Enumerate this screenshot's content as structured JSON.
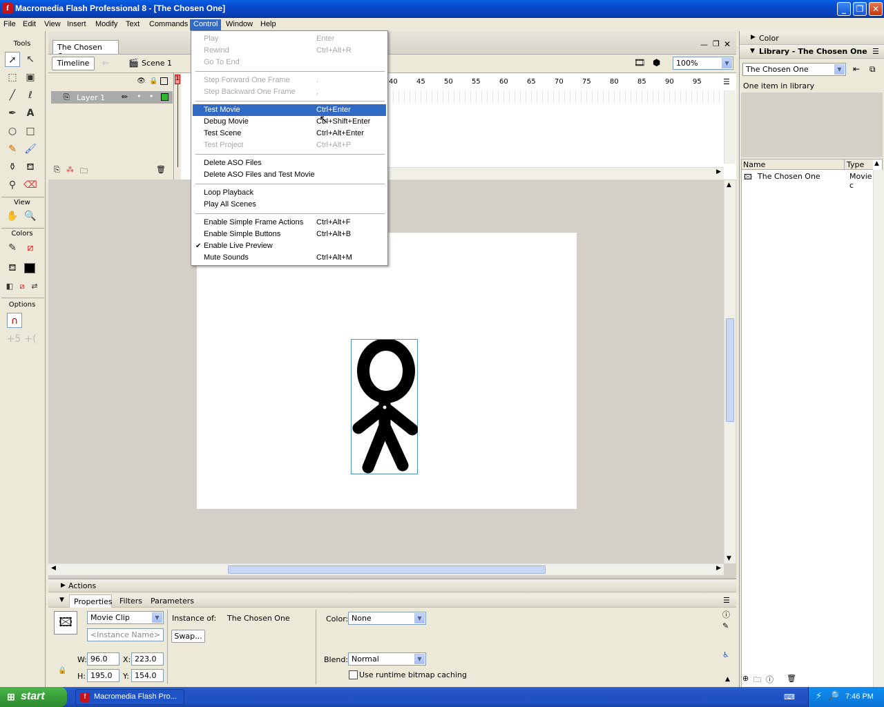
{
  "window": {
    "title": "Macromedia Flash Professional 8 - [The Chosen One]",
    "app_icon": "flash-icon"
  },
  "menubar": [
    "File",
    "Edit",
    "View",
    "Insert",
    "Modify",
    "Text",
    "Commands",
    "Control",
    "Window",
    "Help"
  ],
  "menubar_active": "Control",
  "control_menu": {
    "group1": [
      {
        "label": "Play",
        "shortcut": "Enter",
        "disabled": true
      },
      {
        "label": "Rewind",
        "shortcut": "Ctrl+Alt+R",
        "disabled": true
      },
      {
        "label": "Go To End",
        "shortcut": "",
        "disabled": true
      }
    ],
    "group2": [
      {
        "label": "Step Forward One Frame",
        "shortcut": ".",
        "disabled": true
      },
      {
        "label": "Step Backward One Frame",
        "shortcut": ",",
        "disabled": true
      }
    ],
    "group3": [
      {
        "label": "Test Movie",
        "shortcut": "Ctrl+Enter",
        "highlighted": true
      },
      {
        "label": "Debug Movie",
        "shortcut": "Ctrl+Shift+Enter"
      },
      {
        "label": "Test Scene",
        "shortcut": "Ctrl+Alt+Enter"
      },
      {
        "label": "Test Project",
        "shortcut": "Ctrl+Alt+P",
        "disabled": true
      }
    ],
    "group4": [
      {
        "label": "Delete ASO Files",
        "shortcut": ""
      },
      {
        "label": "Delete ASO Files and Test Movie",
        "shortcut": ""
      }
    ],
    "group5": [
      {
        "label": "Loop Playback",
        "shortcut": ""
      },
      {
        "label": "Play All Scenes",
        "shortcut": ""
      }
    ],
    "group6": [
      {
        "label": "Enable Simple Frame Actions",
        "shortcut": "Ctrl+Alt+F"
      },
      {
        "label": "Enable Simple Buttons",
        "shortcut": "Ctrl+Alt+B"
      },
      {
        "label": "Enable Live Preview",
        "shortcut": "",
        "checked": true
      },
      {
        "label": "Mute Sounds",
        "shortcut": "Ctrl+Alt+M"
      }
    ]
  },
  "tools": {
    "label": "Tools",
    "view_label": "View",
    "colors_label": "Colors",
    "options_label": "Options"
  },
  "document": {
    "tab": "The Chosen One",
    "timeline_button": "Timeline",
    "scene": "Scene 1",
    "zoom": "100%",
    "layer": "Layer 1",
    "frame_numbers": [
      "40",
      "45",
      "50",
      "55",
      "60",
      "65",
      "70",
      "75",
      "80",
      "85",
      "90",
      "95"
    ],
    "playhead": "1"
  },
  "library": {
    "color_panel": "Color",
    "title": "Library - The Chosen One",
    "dropdown": "The Chosen One",
    "count": "One item in library",
    "columns": [
      "Name",
      "Type"
    ],
    "items": [
      {
        "name": "The Chosen One",
        "type": "Movie c"
      }
    ]
  },
  "actions_panel": "Actions",
  "properties": {
    "tabs": [
      "Properties",
      "Filters",
      "Parameters"
    ],
    "symbol_type": "Movie Clip",
    "instance_name_placeholder": "<Instance Name>",
    "instance_of_label": "Instance of:",
    "instance_of": "The Chosen One",
    "swap_label": "Swap...",
    "color_label": "Color:",
    "color_value": "None",
    "w_label": "W:",
    "w": "96.0",
    "h_label": "H:",
    "h": "195.0",
    "x_label": "X:",
    "x": "223.0",
    "y_label": "Y:",
    "y": "154.0",
    "blend_label": "Blend:",
    "blend_value": "Normal",
    "bitmap_caching": "Use runtime bitmap caching"
  },
  "taskbar": {
    "start": "start",
    "task": "Macromedia Flash Pro...",
    "clock": "7:46 PM"
  },
  "colors": {
    "highlight": "#316ac5",
    "titlebar": "#0a5fe4",
    "layer_color": "#2eb82e"
  }
}
